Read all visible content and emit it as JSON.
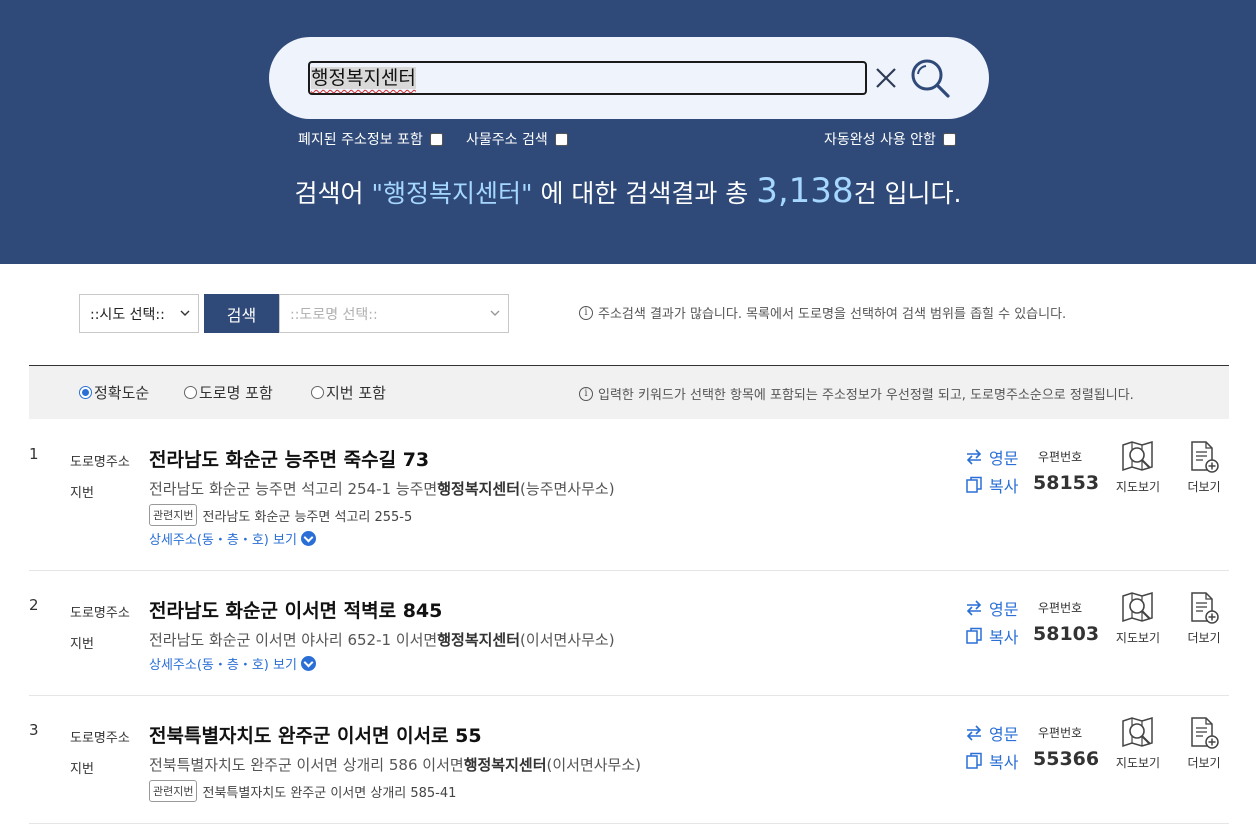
{
  "search": {
    "query": "행정복지센터",
    "options": [
      {
        "label": "폐지된 주소정보 포함",
        "checked": false
      },
      {
        "label": "사물주소 검색",
        "checked": false
      },
      {
        "label": "자동완성 사용 안함",
        "checked": false
      }
    ],
    "summary": {
      "prefix": "검색어",
      "keyword": "\"행정복지센터\"",
      "middle": "에 대한 검색결과 총",
      "count": "3,138",
      "suffix": "건 입니다."
    }
  },
  "filter": {
    "sido_select": "::시도 선택::",
    "search_button": "검색",
    "road_select": "::도로명 선택::",
    "info_icon": "ⓘ",
    "info": "주소검색 결과가 많습니다. 목록에서 도로명을 선택하여 검색 범위를 좁힐 수 있습니다."
  },
  "sort": {
    "options": [
      {
        "label": "정확도순",
        "selected": true
      },
      {
        "label": "도로명 포함",
        "selected": false
      },
      {
        "label": "지번 포함",
        "selected": false
      }
    ],
    "info": "입력한 키워드가 선택한 항목에 포함되는 주소정보가 우선정렬 되고, 도로명주소순으로 정렬됩니다."
  },
  "labels": {
    "road": "도로명주소",
    "jibun": "지번",
    "related_tag": "관련지번",
    "english": "영문",
    "copy": "복사",
    "zip": "우편번호",
    "map": "지도보기",
    "more": "더보기",
    "detail": "상세주소(동・층・호) 보기"
  },
  "results": [
    {
      "num": "1",
      "road": "전라남도 화순군 능주면 죽수길 73",
      "jibun_pre": "전라남도 화순군 능주면 석고리 254-1 능주면",
      "jibun_bold": "행정복지센터",
      "jibun_post": "(능주면사무소)",
      "related": "전라남도 화순군 능주면 석고리 255-5",
      "zip": "58153"
    },
    {
      "num": "2",
      "road": "전라남도 화순군 이서면 적벽로 845",
      "jibun_pre": "전라남도 화순군 이서면 야사리 652-1 이서면",
      "jibun_bold": "행정복지센터",
      "jibun_post": "(이서면사무소)",
      "zip": "58103"
    },
    {
      "num": "3",
      "road": "전북특별자치도 완주군 이서면 이서로 55",
      "jibun_pre": "전북특별자치도 완주군 이서면 상개리 586 이서면",
      "jibun_bold": "행정복지센터",
      "jibun_post": "(이서면사무소)",
      "related": "전북특별자치도 완주군 이서면 상개리 585-41",
      "zip": "55366"
    }
  ],
  "colors": {
    "header_bg": "#2f4a79",
    "accent_blue": "#2a6fd6",
    "highlight_text": "#a6d7ff"
  }
}
